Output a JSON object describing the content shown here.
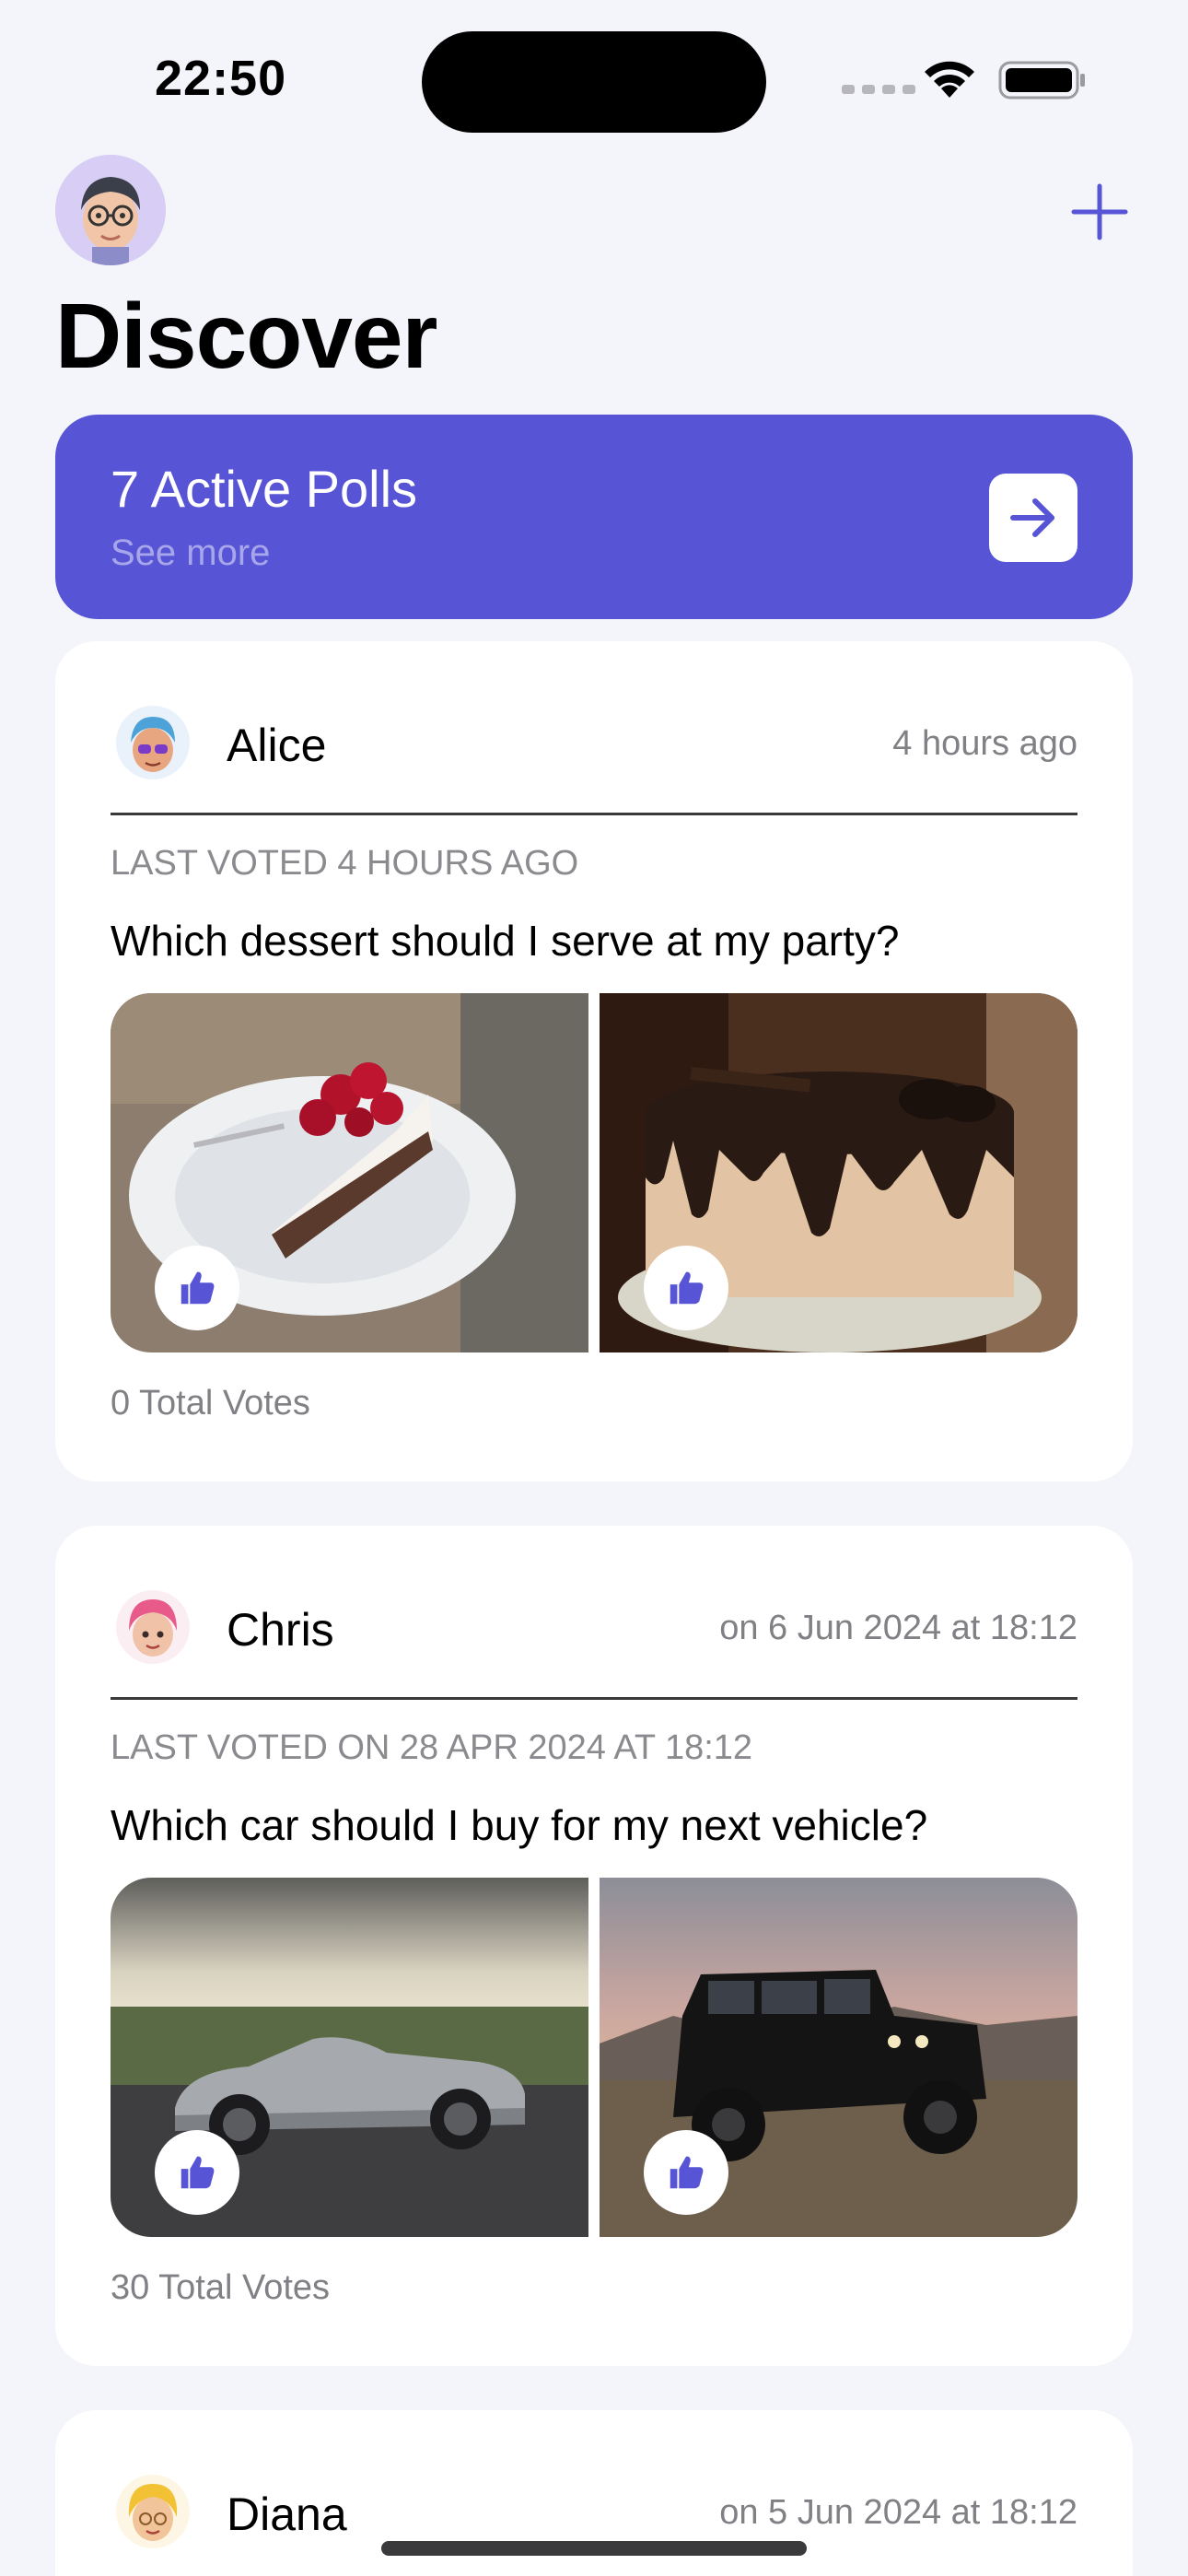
{
  "status_bar": {
    "time": "22:50"
  },
  "header": {
    "title": "Discover"
  },
  "banner": {
    "title": "7 Active Polls",
    "subtitle": "See more"
  },
  "polls": [
    {
      "author": "Alice",
      "time": "4 hours ago",
      "last_voted": "LAST VOTED 4 HOURS AGO",
      "question": "Which dessert should I serve at my party?",
      "votes": "0 Total Votes"
    },
    {
      "author": "Chris",
      "time": "on 6 Jun 2024 at 18:12",
      "last_voted": "LAST VOTED ON 28 APR 2024 AT 18:12",
      "question": "Which car should I buy for my next vehicle?",
      "votes": "30 Total Votes"
    },
    {
      "author": "Diana",
      "time": "on 5 Jun 2024 at 18:12"
    }
  ],
  "colors": {
    "accent": "#5755d6",
    "background": "#f4f5fb"
  },
  "icons": [
    "wifi-icon",
    "battery-icon",
    "plus-icon",
    "arrow-right-icon",
    "thumbs-up-icon"
  ]
}
